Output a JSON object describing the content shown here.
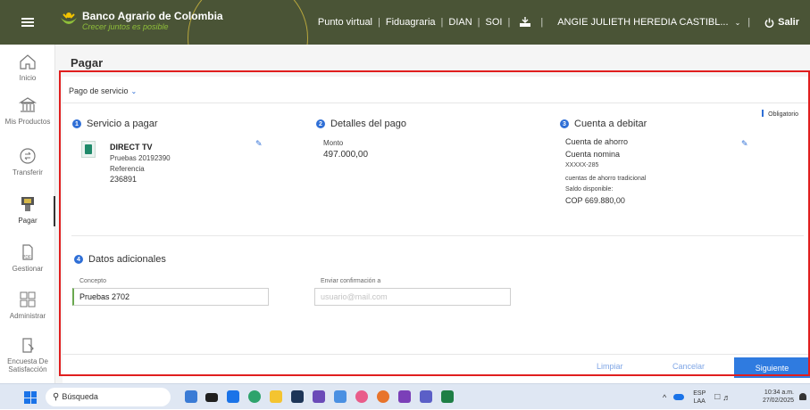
{
  "topbar": {
    "brand_name": "Banco Agrario de Colombia",
    "brand_slogan": "Crecer juntos es posible",
    "links": [
      "Punto virtual",
      "Fiduagraria",
      "DIAN",
      "SOI"
    ],
    "user_name": "ANGIE JULIETH HEREDIA CASTIBL...",
    "logout_label": "Salir"
  },
  "sidebar": {
    "items": [
      {
        "label": "Inicio",
        "icon": "home-icon"
      },
      {
        "label": "Mis Productos",
        "icon": "bank-icon"
      },
      {
        "label": "Transferir",
        "icon": "transfer-icon"
      },
      {
        "label": "Pagar",
        "icon": "pay-icon"
      },
      {
        "label": "Gestionar",
        "icon": "manage-icon"
      },
      {
        "label": "Administrar",
        "icon": "admin-icon"
      },
      {
        "label": "Encuesta De Satisfacción",
        "icon": "survey-icon"
      }
    ]
  },
  "main": {
    "title": "Pagar",
    "payment_type": "Pago de servicio",
    "required_note": "Obligatorio",
    "service": {
      "step": "1",
      "title": "Servicio a pagar",
      "name": "DIRECT TV",
      "sub": "Pruebas 20192390",
      "ref_label": "Referencia",
      "ref_value": "236891"
    },
    "details": {
      "step": "2",
      "title": "Detalles del pago",
      "amount_label": "Monto",
      "amount_value": "497.000,00"
    },
    "debit": {
      "step": "3",
      "title": "Cuenta a debitar",
      "account_type": "Cuenta de ahorro",
      "account_name": "Cuenta nomina",
      "account_number": "XXXXX-285",
      "account_desc": "cuentas de ahorro tradicional",
      "balance_label": "Saldo disponible:",
      "balance_value": "COP 669.880,00"
    },
    "additional": {
      "step": "4",
      "title": "Datos adicionales",
      "concept_label": "Concepto",
      "concept_value": "Pruebas 2702",
      "confirm_label": "Enviar confirmación a",
      "confirm_placeholder": "usuario@mail.com"
    },
    "actions": {
      "clear": "Limpiar",
      "cancel": "Cancelar",
      "next": "Siguiente"
    }
  },
  "taskbar": {
    "search_placeholder": "Búsqueda",
    "lang": "ESP",
    "lang_sub": "LAA",
    "time": "10:34 a.m.",
    "date": "27/02/2025"
  },
  "colors": {
    "topbar_bg": "#4a5436",
    "accent_blue": "#2f7be0",
    "highlight_red": "#e01e1e",
    "brand_green": "#8fbf3a"
  }
}
